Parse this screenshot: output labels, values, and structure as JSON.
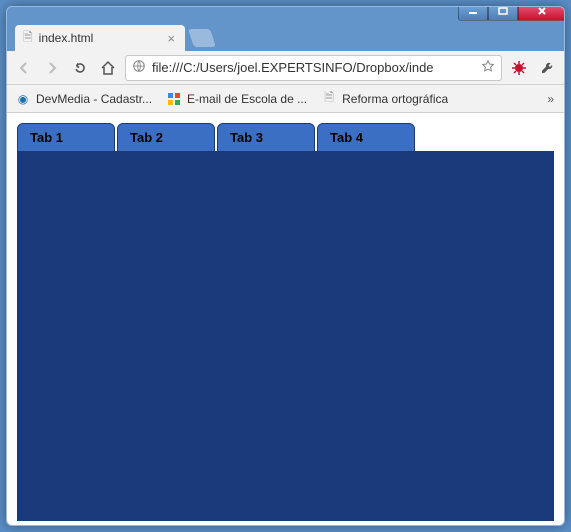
{
  "window": {
    "browser_tab_title": "index.html"
  },
  "toolbar": {
    "url": "file:///C:/Users/joel.EXPERTSINFO/Dropbox/inde"
  },
  "bookmarks": {
    "items": [
      {
        "label": "DevMedia - Cadastr..."
      },
      {
        "label": "E-mail de Escola de ..."
      },
      {
        "label": "Reforma ortográfica"
      }
    ]
  },
  "page": {
    "tabs": [
      {
        "label": "Tab 1"
      },
      {
        "label": "Tab 2"
      },
      {
        "label": "Tab 3"
      },
      {
        "label": "Tab 4"
      }
    ]
  }
}
